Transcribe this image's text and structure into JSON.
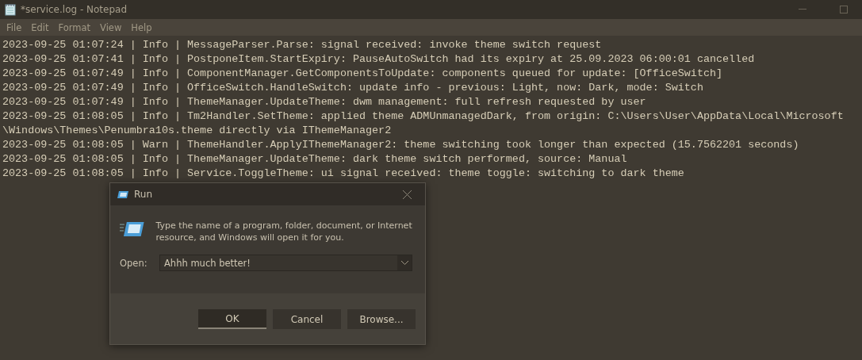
{
  "window": {
    "title": "*service.log - Notepad"
  },
  "menu": [
    "File",
    "Edit",
    "Format",
    "View",
    "Help"
  ],
  "log_lines": [
    "2023-09-25 01:07:24 | Info | MessageParser.Parse: signal received: invoke theme switch request",
    "2023-09-25 01:07:41 | Info | PostponeItem.StartExpiry: PauseAutoSwitch had its expiry at 25.09.2023 06:00:01 cancelled",
    "2023-09-25 01:07:49 | Info | ComponentManager.GetComponentsToUpdate: components queued for update: [OfficeSwitch]",
    "2023-09-25 01:07:49 | Info | OfficeSwitch.HandleSwitch: update info - previous: Light, now: Dark, mode: Switch",
    "2023-09-25 01:07:49 | Info | ThemeManager.UpdateTheme: dwm management: full refresh requested by user",
    "2023-09-25 01:08:05 | Info | Tm2Handler.SetTheme: applied theme ADMUnmanagedDark, from origin: C:\\Users\\User\\AppData\\Local\\Microsoft\\Windows\\Themes\\Penumbra10s.theme directly via IThemeManager2",
    "2023-09-25 01:08:05 | Warn | ThemeHandler.ApplyIThemeManager2: theme switching took longer than expected (15.7562201 seconds)",
    "2023-09-25 01:08:05 | Info | ThemeManager.UpdateTheme: dark theme switch performed, source: Manual",
    "2023-09-25 01:08:05 | Info | Service.ToggleTheme: ui signal received: theme toggle: switching to dark theme"
  ],
  "run_dialog": {
    "title": "Run",
    "description": "Type the name of a program, folder, document, or Internet resource, and Windows will open it for you.",
    "open_label": "Open:",
    "open_value": "Ahhh much better!",
    "buttons": [
      {
        "label": "OK",
        "default": true
      },
      {
        "label": "Cancel",
        "default": false
      },
      {
        "label": "Browse...",
        "default": false
      }
    ]
  }
}
